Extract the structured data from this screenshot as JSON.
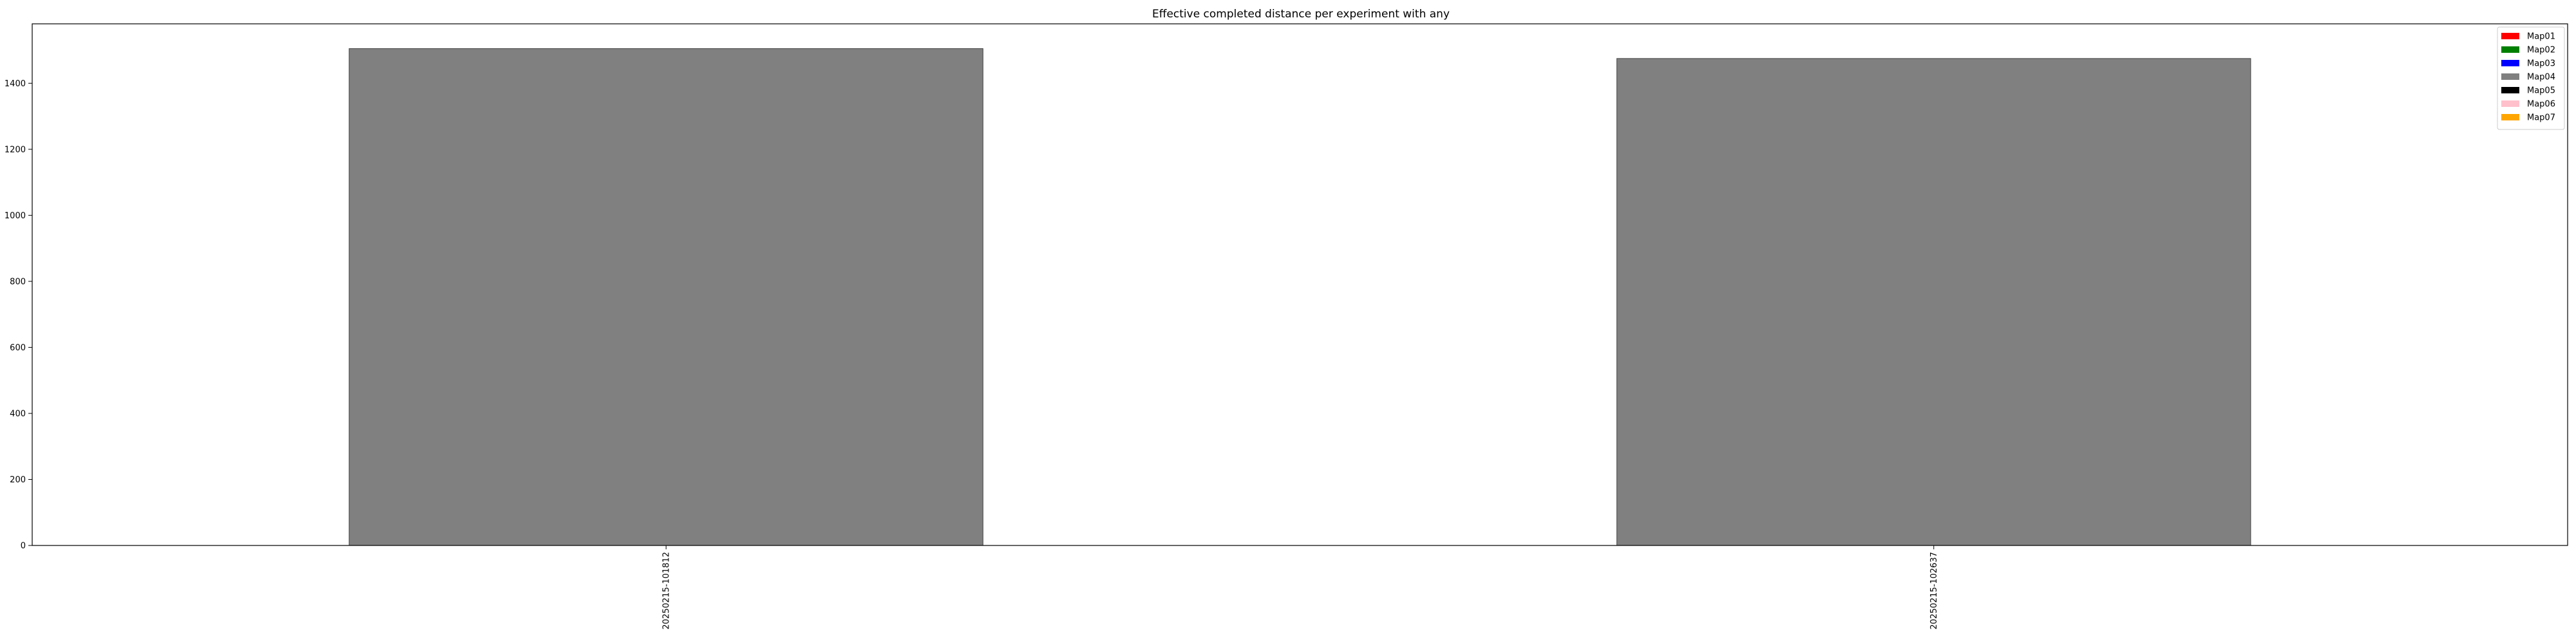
{
  "chart_data": {
    "type": "bar",
    "title": "Effective completed distance per experiment with any",
    "xlabel": "",
    "ylabel": "",
    "categories": [
      "20250215-101812",
      "20250215-102637"
    ],
    "series": [
      {
        "name": "Map01",
        "color": "#ff0000",
        "values": [
          0,
          0
        ]
      },
      {
        "name": "Map02",
        "color": "#008000",
        "values": [
          0,
          0
        ]
      },
      {
        "name": "Map03",
        "color": "#0000ff",
        "values": [
          0,
          0
        ]
      },
      {
        "name": "Map04",
        "color": "#808080",
        "values": [
          1505,
          1475
        ]
      },
      {
        "name": "Map05",
        "color": "#000000",
        "values": [
          0,
          0
        ]
      },
      {
        "name": "Map06",
        "color": "#ffc0cb",
        "values": [
          0,
          0
        ]
      },
      {
        "name": "Map07",
        "color": "#ffa500",
        "values": [
          0,
          0
        ]
      }
    ],
    "ylim": [
      0,
      1580
    ],
    "yticks": [
      0,
      200,
      400,
      600,
      800,
      1000,
      1200,
      1400
    ],
    "grid": false,
    "legend": "top-right",
    "stacked": true
  }
}
